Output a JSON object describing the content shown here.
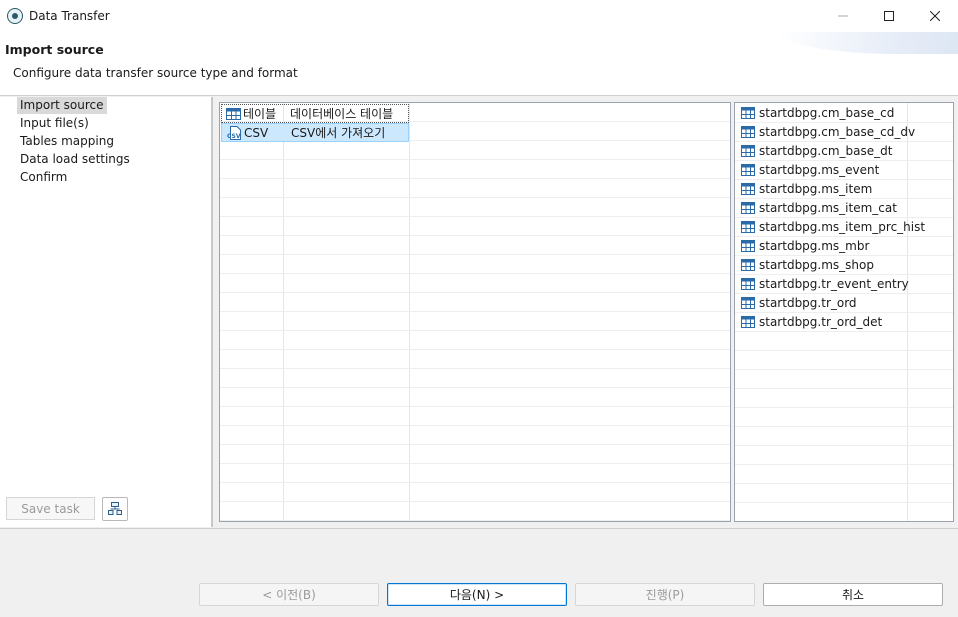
{
  "window": {
    "title": "Data Transfer"
  },
  "header": {
    "title": "Import source",
    "subtitle": "Configure data transfer source type and format"
  },
  "nav": {
    "items": [
      {
        "label": "Import source",
        "active": true
      },
      {
        "label": "Input file(s)"
      },
      {
        "label": "Tables mapping"
      },
      {
        "label": "Data load settings"
      },
      {
        "label": "Confirm"
      }
    ],
    "save_task_label": "Save task"
  },
  "source_types": [
    {
      "icon": "table-icon",
      "name": "테이블",
      "description": "데이터베이스 테이블"
    },
    {
      "icon": "csv-file-icon",
      "name": "CSV",
      "description": "CSV에서 가져오기",
      "selected": true
    }
  ],
  "target_tables": [
    "startdbpg.cm_base_cd",
    "startdbpg.cm_base_cd_dv",
    "startdbpg.cm_base_dt",
    "startdbpg.ms_event",
    "startdbpg.ms_item",
    "startdbpg.ms_item_cat",
    "startdbpg.ms_item_prc_hist",
    "startdbpg.ms_mbr",
    "startdbpg.ms_shop",
    "startdbpg.tr_event_entry",
    "startdbpg.tr_ord",
    "startdbpg.tr_ord_det"
  ],
  "buttons": {
    "back": "< 이전(B)",
    "next": "다음(N) >",
    "proceed": "진행(P)",
    "cancel": "취소"
  },
  "colors": {
    "selection": "#cce8ff",
    "default_button_border": "#0078d7"
  }
}
